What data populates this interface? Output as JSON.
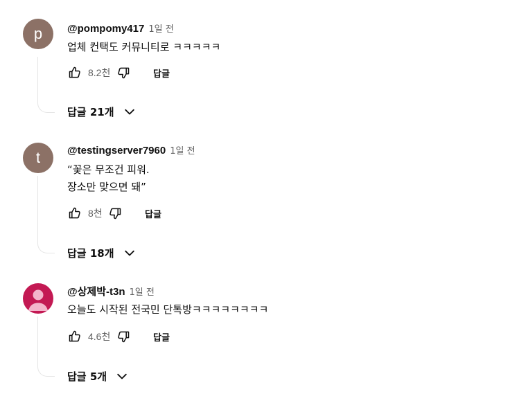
{
  "comments": [
    {
      "author": "@pompomy417",
      "time": "1일 전",
      "avatar_letter": "p",
      "avatar_color": "#8c7166",
      "text": "업체 컨택도 커뮤니티로 ㅋㅋㅋㅋㅋ",
      "likes": "8.2천",
      "reply_label": "답글",
      "replies_label": "답글 21개"
    },
    {
      "author": "@testingserver7960",
      "time": "1일 전",
      "avatar_letter": "t",
      "avatar_color": "#8c7166",
      "text": "“꽃은 무조건 피워.\n장소만 맞으면 돼”",
      "likes": "8천",
      "reply_label": "답글",
      "replies_label": "답글 18개"
    },
    {
      "author": "@상제박-t3n",
      "time": "1일 전",
      "avatar_color": "#c31953",
      "text": "오늘도 시작된 전국민 단톡방ㅋㅋㅋㅋㅋㅋㅋㅋ",
      "likes": "4.6천",
      "reply_label": "답글",
      "replies_label": "답글 5개"
    }
  ]
}
